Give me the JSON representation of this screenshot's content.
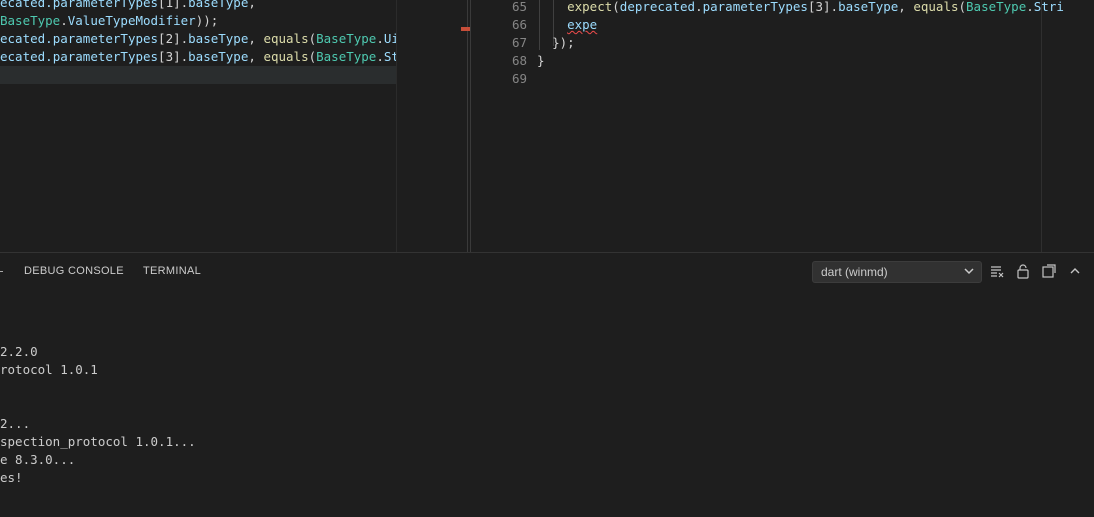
{
  "left_editor": {
    "lines": [
      {
        "segments": [
          {
            "t": "ecated.",
            "c": "vr"
          },
          {
            "t": "parameterTypes",
            "c": "vr"
          },
          {
            "t": "[1].",
            "c": "pl"
          },
          {
            "t": "baseType",
            "c": "vr"
          },
          {
            "t": ",",
            "c": "pl"
          }
        ]
      },
      {
        "segments": [
          {
            "t": "BaseType",
            "c": "ty"
          },
          {
            "t": ".",
            "c": "pl"
          },
          {
            "t": "ValueTypeModifier",
            "c": "vr"
          },
          {
            "t": "));",
            "c": "pl"
          }
        ]
      },
      {
        "segments": [
          {
            "t": "ecated.",
            "c": "vr"
          },
          {
            "t": "parameterTypes",
            "c": "vr"
          },
          {
            "t": "[2].",
            "c": "pl"
          },
          {
            "t": "baseType",
            "c": "vr"
          },
          {
            "t": ", ",
            "c": "pl"
          },
          {
            "t": "equals",
            "c": "fn"
          },
          {
            "t": "(",
            "c": "pl"
          },
          {
            "t": "BaseType",
            "c": "ty"
          },
          {
            "t": ".",
            "c": "pl"
          },
          {
            "t": "Uint",
            "c": "vr"
          }
        ]
      },
      {
        "segments": [
          {
            "t": "ecated.",
            "c": "vr"
          },
          {
            "t": "parameterTypes",
            "c": "vr"
          },
          {
            "t": "[3].",
            "c": "pl"
          },
          {
            "t": "baseType",
            "c": "vr"
          },
          {
            "t": ", ",
            "c": "pl"
          },
          {
            "t": "equals",
            "c": "fn"
          },
          {
            "t": "(",
            "c": "pl"
          },
          {
            "t": "BaseType",
            "c": "ty"
          },
          {
            "t": ".",
            "c": "pl"
          },
          {
            "t": "Stri",
            "c": "vr"
          }
        ]
      },
      {
        "segments": [
          {
            "t": " ",
            "c": "pl"
          }
        ]
      }
    ]
  },
  "right_editor": {
    "line_numbers": [
      "65",
      "66",
      "67",
      "68",
      "69"
    ],
    "lines": [
      {
        "segments": [
          {
            "t": "    ",
            "c": "pl"
          },
          {
            "t": "expect",
            "c": "fn"
          },
          {
            "t": "(",
            "c": "pl"
          },
          {
            "t": "deprecated",
            "c": "vr"
          },
          {
            "t": ".",
            "c": "pl"
          },
          {
            "t": "parameterTypes",
            "c": "vr"
          },
          {
            "t": "[3].",
            "c": "pl"
          },
          {
            "t": "baseType",
            "c": "vr"
          },
          {
            "t": ", ",
            "c": "pl"
          },
          {
            "t": "equals",
            "c": "fn"
          },
          {
            "t": "(",
            "c": "pl"
          },
          {
            "t": "BaseType",
            "c": "ty"
          },
          {
            "t": ".",
            "c": "pl"
          },
          {
            "t": "Stri",
            "c": "vr"
          }
        ]
      },
      {
        "segments": [
          {
            "t": "    ",
            "c": "pl"
          },
          {
            "t": "expe",
            "c": "vr squig"
          }
        ]
      },
      {
        "segments": [
          {
            "t": "  ",
            "c": "pl"
          },
          {
            "t": "});",
            "c": "pl"
          }
        ]
      },
      {
        "segments": [
          {
            "t": "}",
            "c": "pl"
          }
        ]
      },
      {
        "segments": [
          {
            "t": "",
            "c": "pl"
          }
        ]
      }
    ]
  },
  "panel": {
    "tab_debug": "DEBUG CONSOLE",
    "tab_terminal": "TERMINAL",
    "dropdown_value": "dart (winmd)",
    "icons": [
      "clear-output-icon",
      "lock-icon",
      "open-in-editor-icon",
      "chevron-up-icon"
    ]
  },
  "terminal": {
    "lines": [
      "",
      "",
      "",
      "2.2.0",
      "rotocol 1.0.1",
      "",
      "",
      "2...",
      "spection_protocol 1.0.1...",
      "e 8.3.0...",
      "es!"
    ]
  }
}
